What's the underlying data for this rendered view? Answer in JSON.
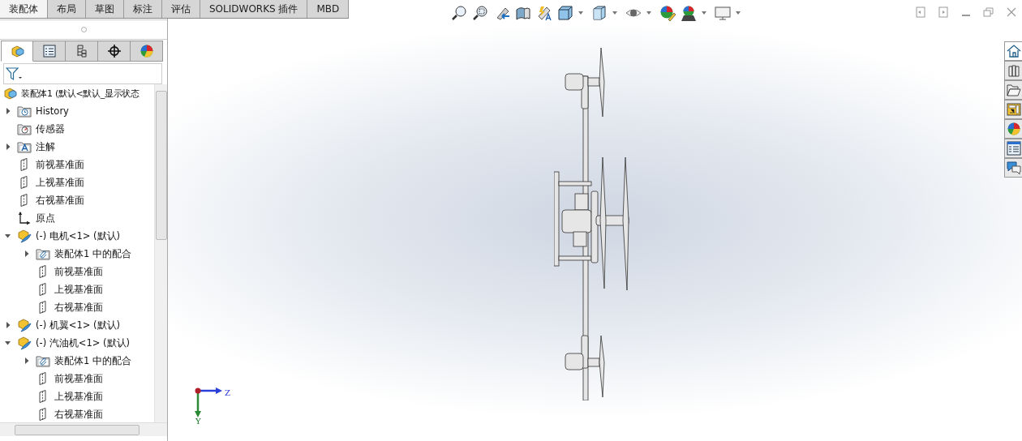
{
  "command_tabs": [
    {
      "label": "装配体",
      "selected": true
    },
    {
      "label": "布局",
      "selected": false
    },
    {
      "label": "草图",
      "selected": false
    },
    {
      "label": "标注",
      "selected": false
    },
    {
      "label": "评估",
      "selected": false
    },
    {
      "label": "SOLIDWORKS 插件",
      "selected": false
    },
    {
      "label": "MBD",
      "selected": false
    }
  ],
  "panel_tabs": [
    {
      "kind": "feature-tree",
      "selected": true
    },
    {
      "kind": "property",
      "selected": false
    },
    {
      "kind": "configuration",
      "selected": false
    },
    {
      "kind": "dimxpert",
      "selected": false
    },
    {
      "kind": "display",
      "selected": false
    }
  ],
  "tree": {
    "label": "装配体1  (默认<默认_显示状态",
    "kind": "assembly",
    "children": [
      {
        "label": "History",
        "kind": "history",
        "expanded": false
      },
      {
        "label": "传感器",
        "kind": "sensor"
      },
      {
        "label": "注解",
        "kind": "annotation",
        "expanded": false
      },
      {
        "label": "前视基准面",
        "kind": "plane"
      },
      {
        "label": "上视基准面",
        "kind": "plane"
      },
      {
        "label": "右视基准面",
        "kind": "plane"
      },
      {
        "label": "原点",
        "kind": "origin"
      },
      {
        "label": "(-) 电机<1> (默认)",
        "kind": "part",
        "expanded": true,
        "children": [
          {
            "label": "装配体1 中的配合",
            "kind": "mates",
            "expanded": false
          },
          {
            "label": "前视基准面",
            "kind": "plane"
          },
          {
            "label": "上视基准面",
            "kind": "plane"
          },
          {
            "label": "右视基准面",
            "kind": "plane"
          }
        ]
      },
      {
        "label": "(-) 机翼<1> (默认)",
        "kind": "part",
        "expanded": false
      },
      {
        "label": "(-) 汽油机<1> (默认)",
        "kind": "part",
        "expanded": true,
        "children": [
          {
            "label": "装配体1 中的配合",
            "kind": "mates",
            "expanded": false
          },
          {
            "label": "前视基准面",
            "kind": "plane"
          },
          {
            "label": "上视基准面",
            "kind": "plane"
          },
          {
            "label": "右视基准面",
            "kind": "plane"
          }
        ]
      }
    ]
  },
  "triad": {
    "x_label": "Z",
    "y_label": "Y"
  }
}
